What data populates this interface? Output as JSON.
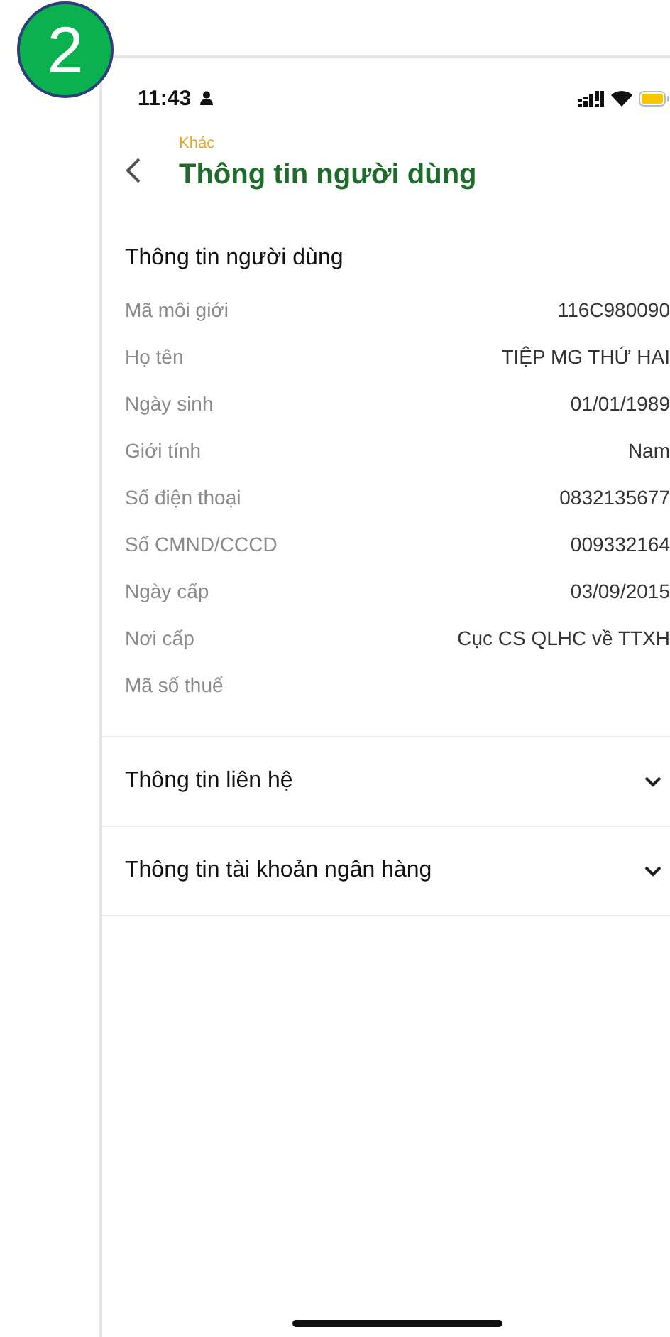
{
  "step_badge": "2",
  "status_bar": {
    "time": "11:43"
  },
  "header": {
    "breadcrumb": "Khác",
    "title": "Thông tin người dùng"
  },
  "user_info": {
    "title": "Thông tin người dùng",
    "rows": [
      {
        "label": "Mã môi giới",
        "value": "116C980090"
      },
      {
        "label": "Họ tên",
        "value": "TIỆP MG THỨ HAI"
      },
      {
        "label": "Ngày sinh",
        "value": "01/01/1989"
      },
      {
        "label": "Giới tính",
        "value": "Nam"
      },
      {
        "label": "Số điện thoại",
        "value": "0832135677"
      },
      {
        "label": "Số CMND/CCCD",
        "value": "009332164"
      },
      {
        "label": "Ngày cấp",
        "value": "03/09/2015"
      },
      {
        "label": "Nơi cấp",
        "value": "Cục CS QLHC về TTXH"
      },
      {
        "label": "Mã số thuế"
      }
    ]
  },
  "sections": [
    {
      "title": "Thông tin liên hệ",
      "expanded": false
    },
    {
      "title": "Thông tin tài khoản ngân hàng",
      "expanded": false
    }
  ]
}
